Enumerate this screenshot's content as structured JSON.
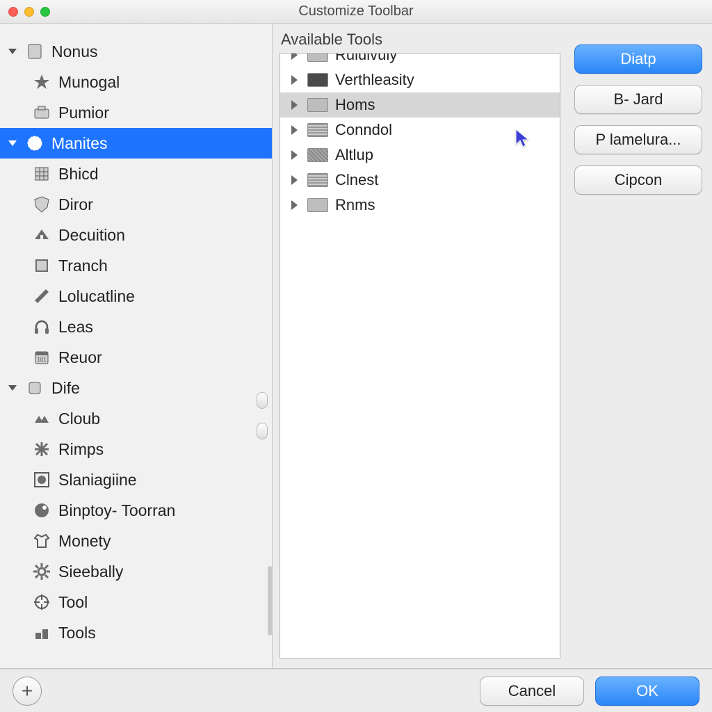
{
  "window": {
    "title": "Customize Toolbar"
  },
  "sidebar": {
    "items": [
      {
        "label": "Nonus",
        "disclosure": true,
        "child": false,
        "icon": "document"
      },
      {
        "label": "Munogal",
        "disclosure": false,
        "child": true,
        "icon": "star"
      },
      {
        "label": "Pumior",
        "disclosure": false,
        "child": true,
        "icon": "camera"
      },
      {
        "label": "Manites",
        "disclosure": true,
        "child": false,
        "icon": "seal",
        "selected": true
      },
      {
        "label": "Bhicd",
        "disclosure": false,
        "child": true,
        "icon": "grid"
      },
      {
        "label": "Diror",
        "disclosure": false,
        "child": true,
        "icon": "shield"
      },
      {
        "label": "Decuition",
        "disclosure": false,
        "child": true,
        "icon": "roof"
      },
      {
        "label": "Tranch",
        "disclosure": false,
        "child": true,
        "icon": "panel"
      },
      {
        "label": "Lolucatline",
        "disclosure": false,
        "child": true,
        "icon": "wrench"
      },
      {
        "label": "Leas",
        "disclosure": false,
        "child": true,
        "icon": "headphones"
      },
      {
        "label": "Reuor",
        "disclosure": false,
        "child": true,
        "icon": "calendar"
      },
      {
        "label": "Dife",
        "disclosure": true,
        "child": false,
        "icon": "cube",
        "stub": true
      },
      {
        "label": "Cloub",
        "disclosure": false,
        "child": true,
        "icon": "triangles",
        "stub": true
      },
      {
        "label": "Rimps",
        "disclosure": false,
        "child": true,
        "icon": "asterisk"
      },
      {
        "label": "Slaniagiine",
        "disclosure": false,
        "child": true,
        "icon": "circle"
      },
      {
        "label": "Binptoy- Toorran",
        "disclosure": false,
        "child": true,
        "icon": "disc"
      },
      {
        "label": "Monety",
        "disclosure": false,
        "child": true,
        "icon": "shirt"
      },
      {
        "label": "Sieebally",
        "disclosure": false,
        "child": true,
        "icon": "gear"
      },
      {
        "label": "Tool",
        "disclosure": false,
        "child": true,
        "icon": "target"
      },
      {
        "label": "Tools",
        "disclosure": false,
        "child": true,
        "icon": "blocks"
      }
    ]
  },
  "available": {
    "title": "Available Tools",
    "items": [
      {
        "label": "Ruluivuly",
        "thumb": "plain",
        "cut": true
      },
      {
        "label": "Verthleasity",
        "thumb": "dark"
      },
      {
        "label": "Homs",
        "thumb": "plain",
        "selected": true
      },
      {
        "label": "Conndol",
        "thumb": "lines"
      },
      {
        "label": "Altlup",
        "thumb": "tex"
      },
      {
        "label": "Clnest",
        "thumb": "lines"
      },
      {
        "label": "Rnms",
        "thumb": "plain"
      }
    ]
  },
  "buttons": {
    "primary": "Diatp",
    "b2": "B- Jard",
    "b3": "P lamelura...",
    "b4": "Cipcon"
  },
  "footer": {
    "cancel": "Cancel",
    "ok": "OK"
  }
}
